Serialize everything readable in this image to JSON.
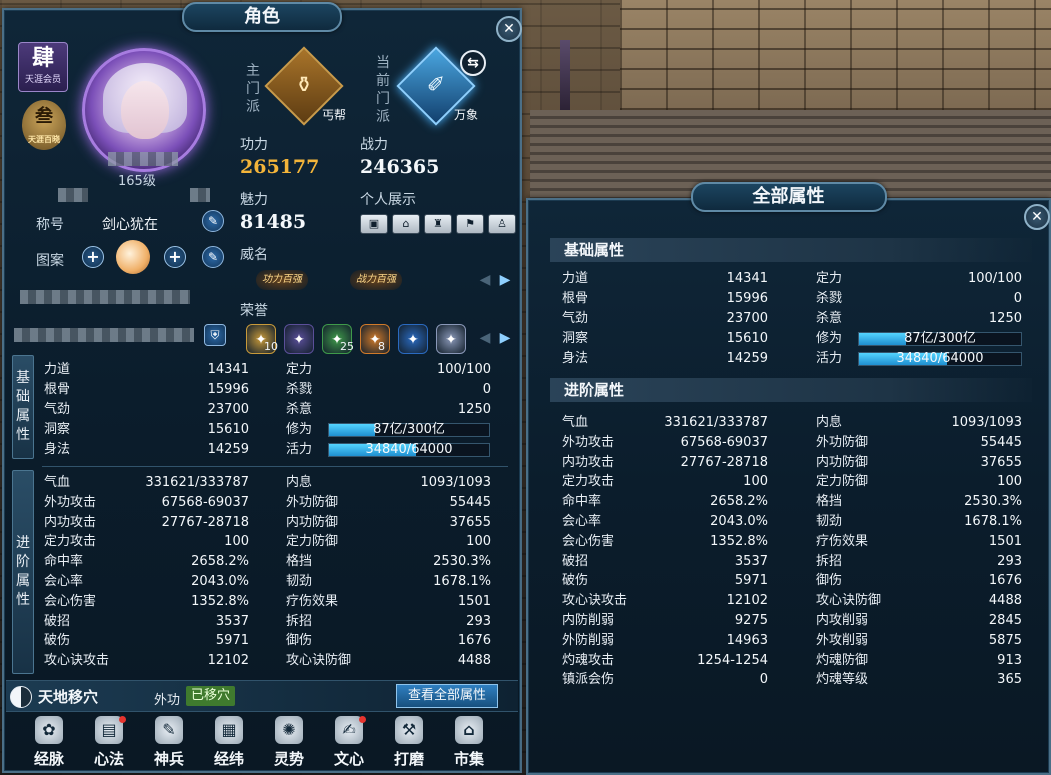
{
  "character_panel": {
    "title": "角色",
    "close_label": "✕",
    "rank_badge": {
      "glyph": "肆",
      "sub": "天涯会员"
    },
    "gold_badge": {
      "glyph": "叁",
      "sub": "天涯百晓"
    },
    "level": "165级",
    "title_label": "称号",
    "title_value": "剑心犹在",
    "pattern_label": "图案",
    "main_sect": {
      "vlabel": "主门派",
      "name": "丐帮",
      "icon": "gourd-icon"
    },
    "current_sect": {
      "vlabel": "当前门派",
      "name": "万象",
      "icon": "brush-icon"
    },
    "swap_label": "⇆",
    "kungfu_label": "功力",
    "kungfu_value": "265177",
    "combat_label": "战力",
    "combat_value": "246365",
    "charm_label": "魅力",
    "charm_value": "81485",
    "showcase_label": "个人展示",
    "showcase_buttons": [
      "名片",
      "家园",
      "坐骑",
      "时装",
      "服饰"
    ],
    "prestige_label": "威名",
    "prestige_tags": [
      "功力百强",
      "战力百强"
    ],
    "honor_label": "荣誉",
    "honors": [
      {
        "icon": "hand-icon",
        "count": "10",
        "color": "#c89a3a"
      },
      {
        "icon": "c-icon",
        "count": "",
        "color": "#5b4f9a"
      },
      {
        "icon": "talk-icon",
        "count": "25",
        "color": "#3f9a4a"
      },
      {
        "icon": "master-icon",
        "count": "8",
        "color": "#d07a2a"
      },
      {
        "icon": "rank-icon",
        "count": "",
        "color": "#2a6ac0"
      },
      {
        "icon": "gem-icon",
        "count": "",
        "color": "#8a98b8"
      }
    ],
    "basic_tab": "基础属性",
    "advanced_tab": "进阶属性",
    "transfer": {
      "title": "天地移穴",
      "label": "外功",
      "status": "已移穴",
      "view_all": "查看全部属性"
    },
    "nav": [
      {
        "label": "经脉",
        "icon": "meridian-icon",
        "dot": false
      },
      {
        "label": "心法",
        "icon": "book-icon",
        "dot": true
      },
      {
        "label": "神兵",
        "icon": "weapon-icon",
        "dot": false
      },
      {
        "label": "经纬",
        "icon": "grid-icon",
        "dot": false
      },
      {
        "label": "灵势",
        "icon": "spirit-icon",
        "dot": false
      },
      {
        "label": "文心",
        "icon": "pen-icon",
        "dot": true
      },
      {
        "label": "打磨",
        "icon": "hammer-icon",
        "dot": false
      },
      {
        "label": "市集",
        "icon": "market-icon",
        "dot": false
      }
    ]
  },
  "all_attributes_panel": {
    "title": "全部属性",
    "close_label": "✕",
    "basic_head": "基础属性",
    "advanced_head": "进阶属性"
  },
  "basic_attrs": {
    "left": [
      {
        "k": "力道",
        "v": "14341"
      },
      {
        "k": "根骨",
        "v": "15996"
      },
      {
        "k": "气劲",
        "v": "23700"
      },
      {
        "k": "洞察",
        "v": "15610"
      },
      {
        "k": "身法",
        "v": "14259"
      }
    ],
    "right": [
      {
        "k": "定力",
        "v": "100/100"
      },
      {
        "k": "杀戮",
        "v": "0"
      },
      {
        "k": "杀意",
        "v": "1250"
      }
    ],
    "cultivation": {
      "k": "修为",
      "text": "87亿/300亿",
      "fraction": 0.29
    },
    "vitality": {
      "k": "活力",
      "text": "34840/64000",
      "fraction": 0.544
    }
  },
  "advanced_attrs": {
    "left": [
      {
        "k": "气血",
        "v": "331621/333787"
      },
      {
        "k": "外功攻击",
        "v": "67568-69037"
      },
      {
        "k": "内功攻击",
        "v": "27767-28718"
      },
      {
        "k": "定力攻击",
        "v": "100"
      },
      {
        "k": "命中率",
        "v": "2658.2%"
      },
      {
        "k": "会心率",
        "v": "2043.0%"
      },
      {
        "k": "会心伤害",
        "v": "1352.8%"
      },
      {
        "k": "破招",
        "v": "3537"
      },
      {
        "k": "破伤",
        "v": "5971"
      },
      {
        "k": "攻心诀攻击",
        "v": "12102"
      },
      {
        "k": "内防削弱",
        "v": "9275"
      },
      {
        "k": "外防削弱",
        "v": "14963"
      },
      {
        "k": "灼魂攻击",
        "v": "1254-1254"
      },
      {
        "k": "镇派会伤",
        "v": "0"
      }
    ],
    "right": [
      {
        "k": "内息",
        "v": "1093/1093"
      },
      {
        "k": "外功防御",
        "v": "55445"
      },
      {
        "k": "内功防御",
        "v": "37655"
      },
      {
        "k": "定力防御",
        "v": "100"
      },
      {
        "k": "格挡",
        "v": "2530.3%"
      },
      {
        "k": "韧劲",
        "v": "1678.1%"
      },
      {
        "k": "疗伤效果",
        "v": "1501"
      },
      {
        "k": "拆招",
        "v": "293"
      },
      {
        "k": "御伤",
        "v": "1676"
      },
      {
        "k": "攻心诀防御",
        "v": "4488"
      },
      {
        "k": "内攻削弱",
        "v": "2845"
      },
      {
        "k": "外攻削弱",
        "v": "5875"
      },
      {
        "k": "灼魂防御",
        "v": "913"
      },
      {
        "k": "灼魂等级",
        "v": "365"
      }
    ]
  }
}
